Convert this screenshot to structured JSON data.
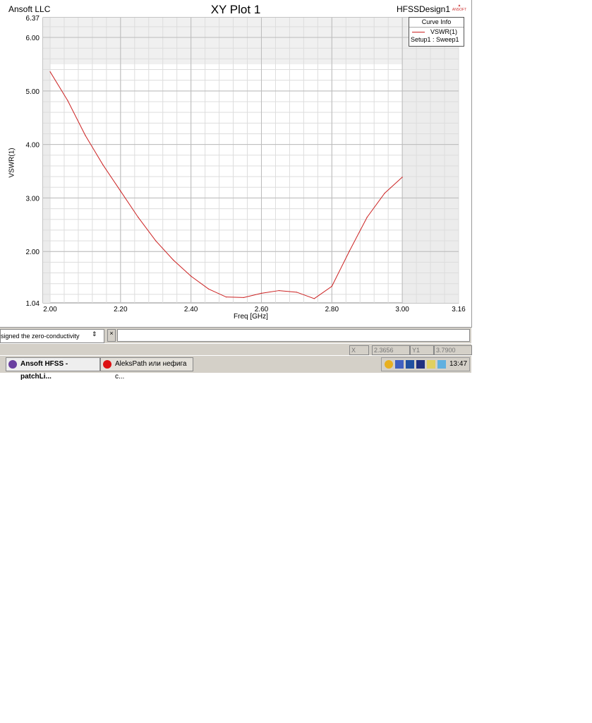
{
  "header": {
    "company": "Ansoft LLC",
    "title": "XY Plot 1",
    "design": "HFSSDesign1",
    "logo_text": "ANSOFT"
  },
  "legend": {
    "title": "Curve Info",
    "curve": "VSWR(1)",
    "setup": "Setup1 : Sweep1",
    "curve_color": "#cc2222"
  },
  "chart_data": {
    "type": "line",
    "title": "XY Plot 1",
    "xlabel": "Freq [GHz]",
    "ylabel": "VSWR(1)",
    "xlim": [
      2.0,
      3.16
    ],
    "ylim": [
      1.04,
      6.37
    ],
    "x_ticks": [
      "2.00",
      "2.20",
      "2.40",
      "2.60",
      "2.80",
      "3.00",
      "3.16"
    ],
    "y_ticks": [
      "6.37",
      "6.00",
      "5.00",
      "4.00",
      "3.00",
      "2.00",
      "1.04"
    ],
    "grid": true,
    "series": [
      {
        "name": "VSWR(1)",
        "x": [
          2.0,
          2.05,
          2.1,
          2.15,
          2.2,
          2.25,
          2.3,
          2.35,
          2.4,
          2.45,
          2.5,
          2.55,
          2.6,
          2.65,
          2.7,
          2.75,
          2.8,
          2.85,
          2.9,
          2.95,
          3.0
        ],
        "y": [
          5.36,
          4.82,
          4.17,
          3.62,
          3.13,
          2.64,
          2.2,
          1.84,
          1.54,
          1.3,
          1.15,
          1.14,
          1.22,
          1.27,
          1.24,
          1.12,
          1.35,
          2.01,
          2.64,
          3.09,
          3.39
        ]
      }
    ]
  },
  "message": {
    "line1": "signed the zero-conductivity",
    "close": "×"
  },
  "status": {
    "x_label": "X",
    "x_value": "2.3656",
    "y_label": "Y1",
    "y_value": "3.7900"
  },
  "taskbar": {
    "tasks": [
      "Ansoft HFSS - patchLi...",
      "AleksPath или нефига с..."
    ],
    "clock": "13:47"
  }
}
